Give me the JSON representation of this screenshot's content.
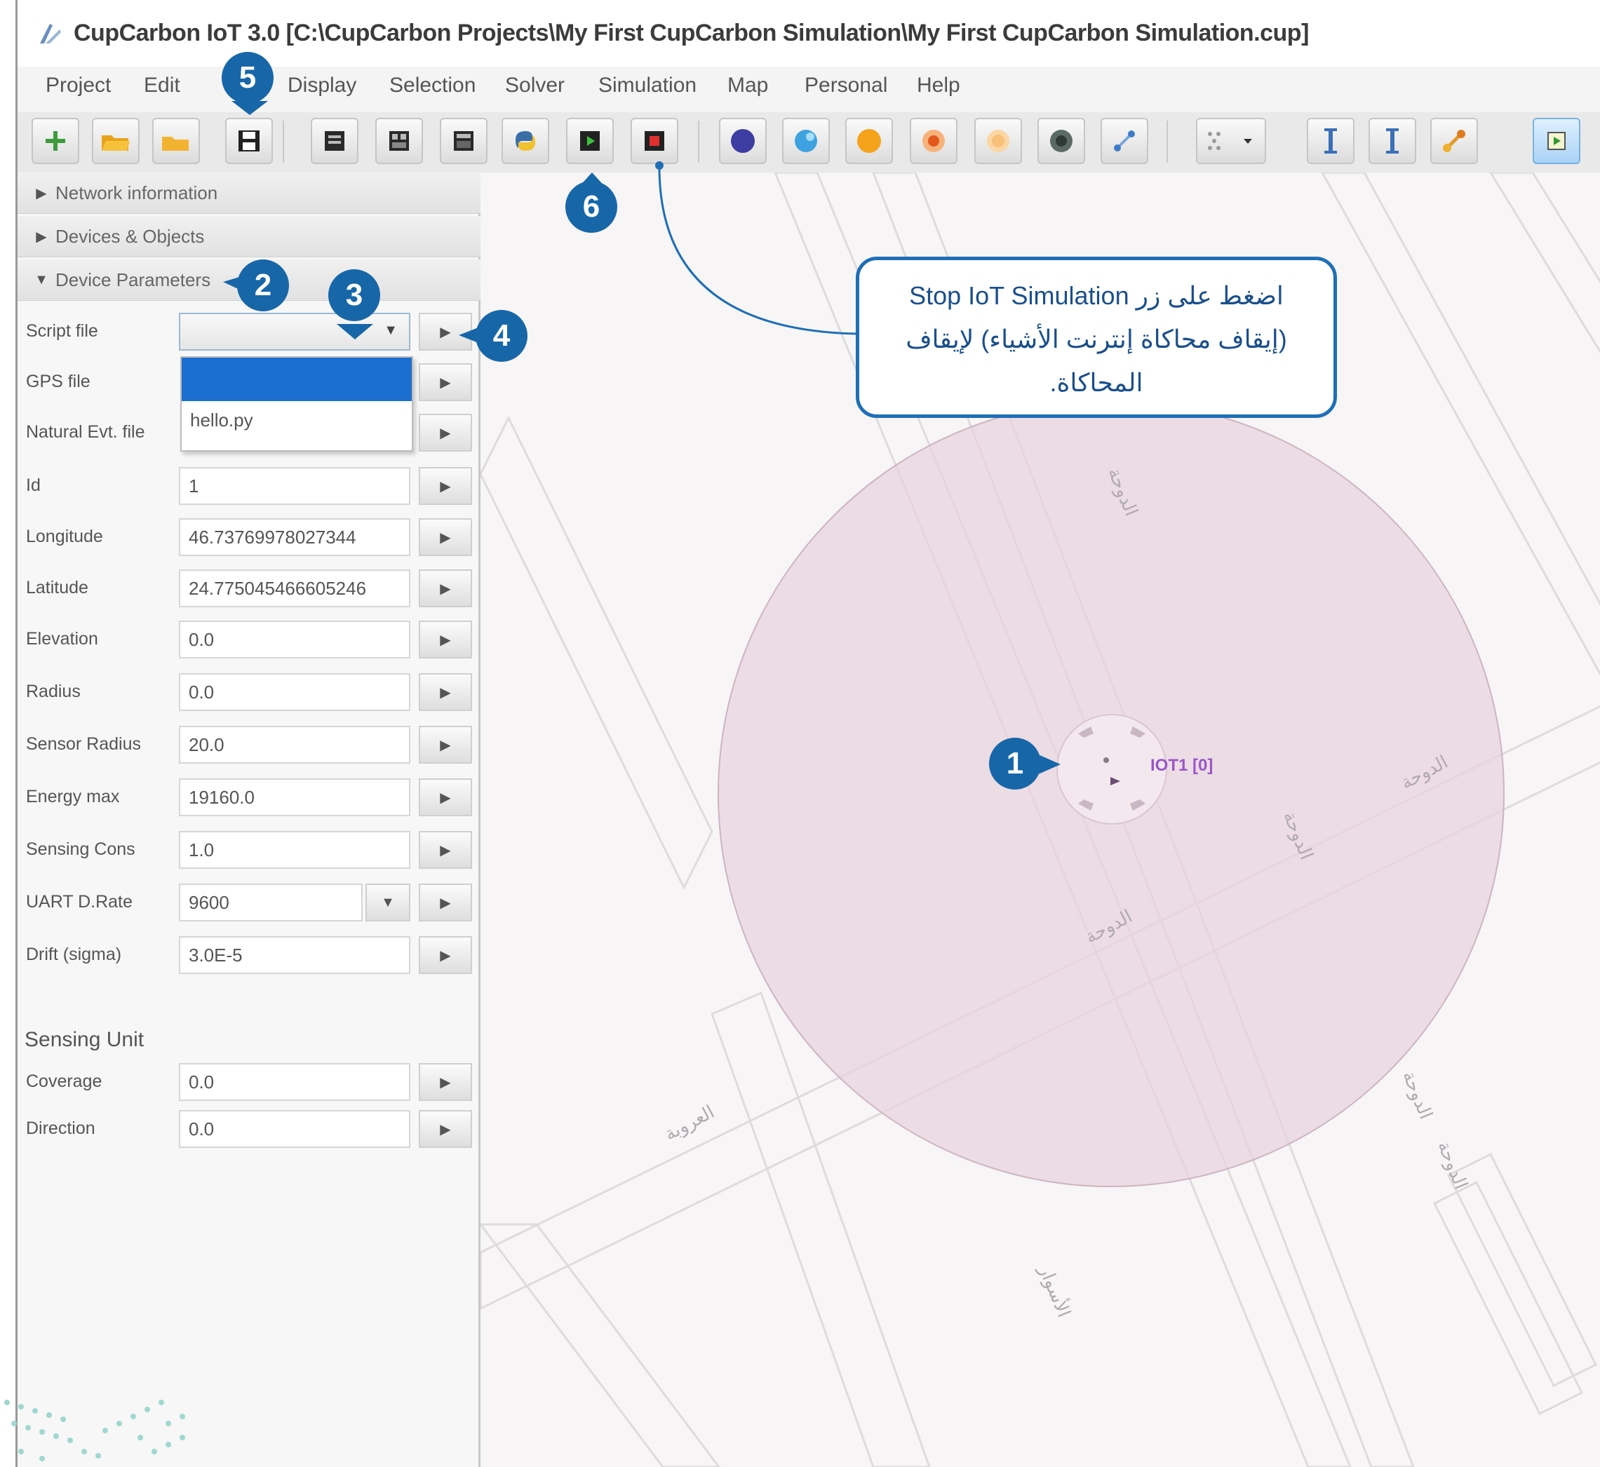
{
  "window": {
    "title": "CupCarbon IoT 3.0 [C:\\CupCarbon Projects\\My First CupCarbon Simulation\\My First CupCarbon Simulation.cup]"
  },
  "menu": [
    "Project",
    "Edit",
    "Display",
    "Selection",
    "Solver",
    "Simulation",
    "Map",
    "Personal",
    "Help"
  ],
  "toolbar": {
    "icons": [
      "add-icon",
      "open-folder-icon",
      "folder-icon",
      "save-icon",
      "iot-board-icon",
      "multi-board-icon",
      "board-icon",
      "python-icon",
      "run-simulation-icon",
      "stop-simulation-icon",
      "node-blue-icon",
      "node-lightblue-icon",
      "node-orange-icon",
      "node-red-icon",
      "node-lightorange-icon",
      "node-dark-icon",
      "connect-icon",
      "grid-dropdown-icon",
      "vertical-bar-icon",
      "vertical-bar-icon-2",
      "route-icon",
      "play-icon"
    ]
  },
  "panel": {
    "sections": [
      "Network information",
      "Devices & Objects",
      "Device Parameters"
    ],
    "params": [
      {
        "label": "Script file",
        "value": ""
      },
      {
        "label": "GPS file",
        "value": ""
      },
      {
        "label": "Natural Evt. file",
        "value": ""
      },
      {
        "label": "Id",
        "value": "1"
      },
      {
        "label": "Longitude",
        "value": "46.73769978027344"
      },
      {
        "label": "Latitude",
        "value": "24.775045466605246"
      },
      {
        "label": "Elevation",
        "value": "0.0"
      },
      {
        "label": "Radius",
        "value": "0.0"
      },
      {
        "label": "Sensor Radius",
        "value": "20.0"
      },
      {
        "label": "Energy max",
        "value": "19160.0"
      },
      {
        "label": "Sensing Cons",
        "value": "1.0"
      },
      {
        "label": "UART D.Rate",
        "value": "9600"
      },
      {
        "label": "Drift (sigma)",
        "value": "3.0E-5"
      }
    ],
    "dropdown_option": "hello.py",
    "sensing_unit": {
      "title": "Sensing Unit",
      "params": [
        {
          "label": "Coverage",
          "value": "0.0"
        },
        {
          "label": "Direction",
          "value": "0.0"
        }
      ]
    }
  },
  "map": {
    "node_label": "IOT1 [0]",
    "street_labels": [
      "الدوحة",
      "الدوحة",
      "الدوحة",
      "الدوحة",
      "العروبة",
      "الدوحة",
      "الدوحة",
      "الأسوار"
    ]
  },
  "badges": [
    "1",
    "2",
    "3",
    "4",
    "5",
    "6"
  ],
  "callout": {
    "line1": "اضغط على زر Stop IoT Simulation",
    "line2": "(إيقاف محاكاة إنترنت الأشياء) لإيقاف",
    "line3": "المحاكاة."
  },
  "colors": {
    "badge": "#1767a8",
    "callout_border": "#1e6fb6",
    "selection": "#1a6fd0",
    "node_label": "#9a57c8",
    "coverage": "#e8d3de"
  }
}
